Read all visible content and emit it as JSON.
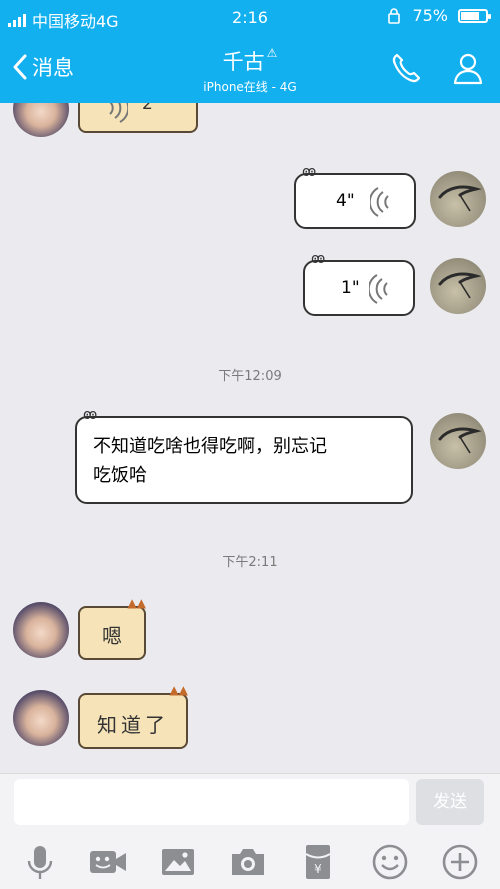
{
  "status": {
    "carrier": "中国移动4G",
    "time": "2:16",
    "battery": "75%",
    "battery_level": 0.75
  },
  "header": {
    "back_label": "消息",
    "contact_name": "千古",
    "contact_status": "iPhone在线 - 4G"
  },
  "messages": [
    {
      "dir": "in",
      "type": "voice",
      "duration": "2\""
    },
    {
      "dir": "out",
      "type": "voice",
      "duration": "4\""
    },
    {
      "dir": "out",
      "type": "voice",
      "duration": "1\""
    },
    {
      "type": "time",
      "text": "下午12:09"
    },
    {
      "dir": "out",
      "type": "text",
      "line1": "不知道吃啥也得吃啊，别忘记",
      "line2": "吃饭哈"
    },
    {
      "type": "time",
      "text": "下午2:11"
    },
    {
      "dir": "in",
      "type": "sticker",
      "text": "嗯"
    },
    {
      "dir": "in",
      "type": "sticker",
      "text": "知道了"
    }
  ],
  "input": {
    "placeholder": "",
    "send_label": "发送"
  },
  "toolbar": [
    "microphone-icon",
    "video-icon",
    "image-icon",
    "camera-icon",
    "red-packet-icon",
    "emoji-icon",
    "plus-icon"
  ],
  "colors": {
    "header": "#13b0f0",
    "background": "#ebebef",
    "sticker": "#f6e4b8"
  }
}
